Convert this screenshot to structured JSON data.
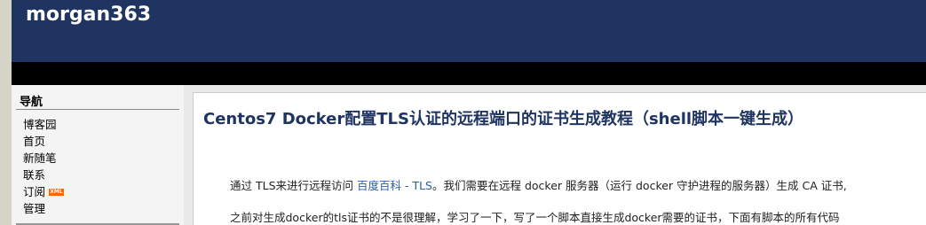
{
  "header": {
    "blog_title": "morgan363"
  },
  "sidebar": {
    "nav_title": "导航",
    "items": [
      {
        "label": "博客园"
      },
      {
        "label": "首页"
      },
      {
        "label": "新随笔"
      },
      {
        "label": "联系"
      },
      {
        "label": "订阅"
      },
      {
        "label": "管理"
      }
    ],
    "rss_badge": "XML"
  },
  "post": {
    "title": "Centos7 Docker配置TLS认证的远程端口的证书生成教程（shell脚本一键生成）",
    "para1_before": "通过 TLS来进行远程访问 ",
    "para1_link": "百度百科 - TLS",
    "para1_after": "。我们需要在远程 docker 服务器（运行 docker 守护进程的服务器）生成 CA 证书,",
    "para2": "之前对生成docker的tls证书的不是很理解，学习了一下，写了一个脚本直接生成docker需要的证书，下面有脚本的所有代码"
  }
}
